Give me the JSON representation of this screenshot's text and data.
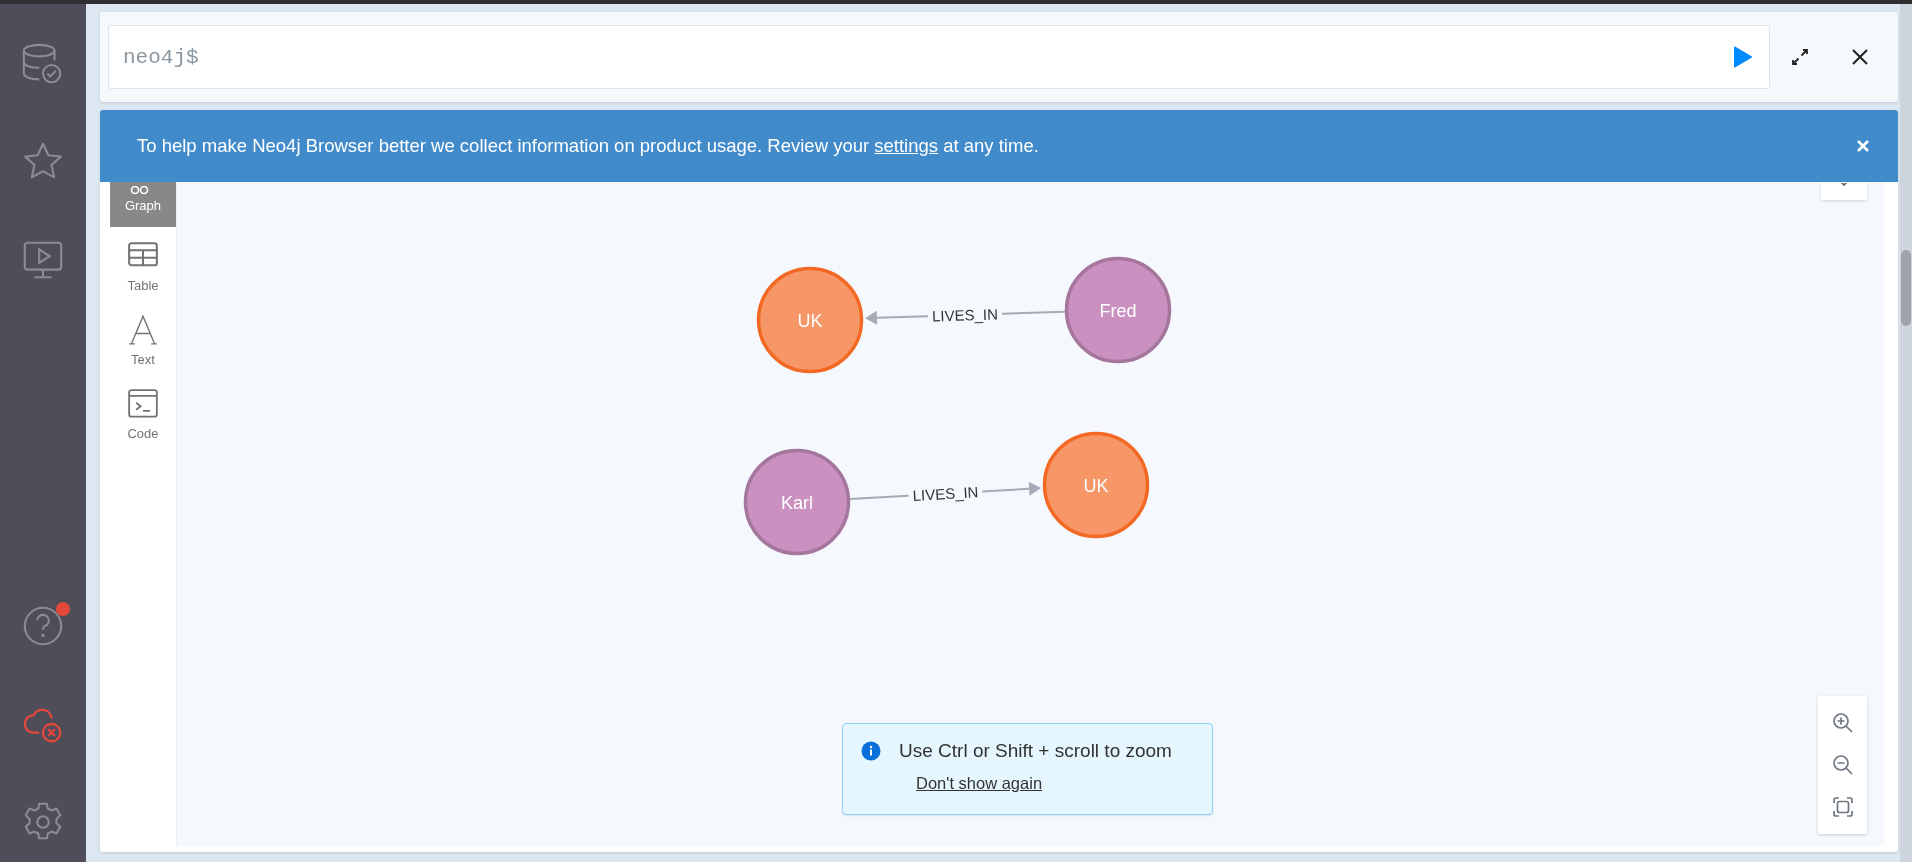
{
  "sidebar": {
    "help_notification": true,
    "connected": false
  },
  "editor": {
    "prompt": "neo4j$"
  },
  "banner": {
    "text_before": "To help make Neo4j Browser better we collect information on product usage. Review your ",
    "link": "settings",
    "text_after": " at any time."
  },
  "view_tabs": [
    {
      "label": "Graph",
      "kind": "graph",
      "selected": true
    },
    {
      "label": "Table",
      "kind": "table",
      "selected": false
    },
    {
      "label": "Text",
      "kind": "text",
      "selected": false
    },
    {
      "label": "Code",
      "kind": "code",
      "selected": false
    }
  ],
  "graph": {
    "nodes": [
      {
        "label": "UK",
        "color": "#f79767"
      },
      {
        "label": "Fred",
        "color": "#c990c0"
      },
      {
        "label": "Karl",
        "color": "#c990c0"
      },
      {
        "label": "UK",
        "color": "#f79767"
      }
    ],
    "relationships": [
      {
        "label": "LIVES_IN"
      },
      {
        "label": "LIVES_IN"
      }
    ]
  },
  "toast": {
    "message": "Use Ctrl or Shift + scroll to zoom",
    "link": "Don't show again"
  }
}
